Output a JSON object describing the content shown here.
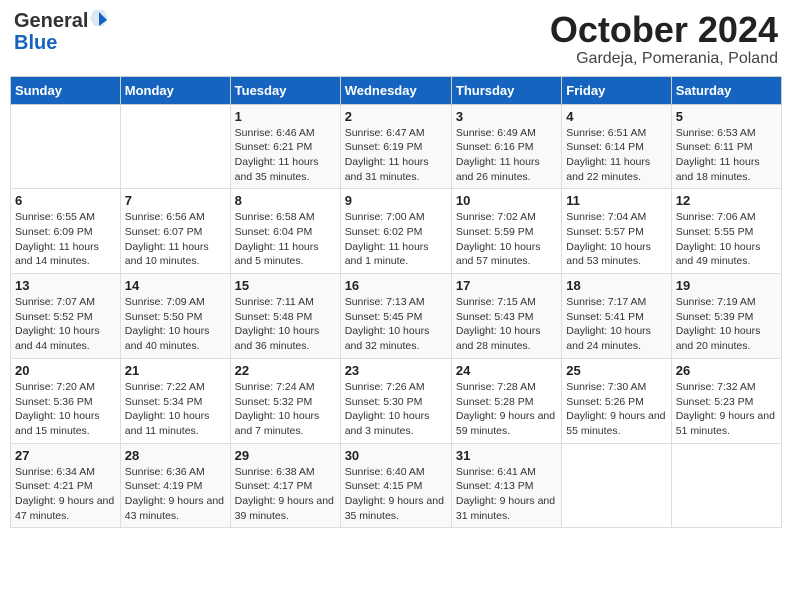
{
  "header": {
    "logo_general": "General",
    "logo_blue": "Blue",
    "title": "October 2024",
    "subtitle": "Gardeja, Pomerania, Poland"
  },
  "columns": [
    "Sunday",
    "Monday",
    "Tuesday",
    "Wednesday",
    "Thursday",
    "Friday",
    "Saturday"
  ],
  "weeks": [
    [
      {
        "day": "",
        "info": ""
      },
      {
        "day": "",
        "info": ""
      },
      {
        "day": "1",
        "info": "Sunrise: 6:46 AM\nSunset: 6:21 PM\nDaylight: 11 hours and 35 minutes."
      },
      {
        "day": "2",
        "info": "Sunrise: 6:47 AM\nSunset: 6:19 PM\nDaylight: 11 hours and 31 minutes."
      },
      {
        "day": "3",
        "info": "Sunrise: 6:49 AM\nSunset: 6:16 PM\nDaylight: 11 hours and 26 minutes."
      },
      {
        "day": "4",
        "info": "Sunrise: 6:51 AM\nSunset: 6:14 PM\nDaylight: 11 hours and 22 minutes."
      },
      {
        "day": "5",
        "info": "Sunrise: 6:53 AM\nSunset: 6:11 PM\nDaylight: 11 hours and 18 minutes."
      }
    ],
    [
      {
        "day": "6",
        "info": "Sunrise: 6:55 AM\nSunset: 6:09 PM\nDaylight: 11 hours and 14 minutes."
      },
      {
        "day": "7",
        "info": "Sunrise: 6:56 AM\nSunset: 6:07 PM\nDaylight: 11 hours and 10 minutes."
      },
      {
        "day": "8",
        "info": "Sunrise: 6:58 AM\nSunset: 6:04 PM\nDaylight: 11 hours and 5 minutes."
      },
      {
        "day": "9",
        "info": "Sunrise: 7:00 AM\nSunset: 6:02 PM\nDaylight: 11 hours and 1 minute."
      },
      {
        "day": "10",
        "info": "Sunrise: 7:02 AM\nSunset: 5:59 PM\nDaylight: 10 hours and 57 minutes."
      },
      {
        "day": "11",
        "info": "Sunrise: 7:04 AM\nSunset: 5:57 PM\nDaylight: 10 hours and 53 minutes."
      },
      {
        "day": "12",
        "info": "Sunrise: 7:06 AM\nSunset: 5:55 PM\nDaylight: 10 hours and 49 minutes."
      }
    ],
    [
      {
        "day": "13",
        "info": "Sunrise: 7:07 AM\nSunset: 5:52 PM\nDaylight: 10 hours and 44 minutes."
      },
      {
        "day": "14",
        "info": "Sunrise: 7:09 AM\nSunset: 5:50 PM\nDaylight: 10 hours and 40 minutes."
      },
      {
        "day": "15",
        "info": "Sunrise: 7:11 AM\nSunset: 5:48 PM\nDaylight: 10 hours and 36 minutes."
      },
      {
        "day": "16",
        "info": "Sunrise: 7:13 AM\nSunset: 5:45 PM\nDaylight: 10 hours and 32 minutes."
      },
      {
        "day": "17",
        "info": "Sunrise: 7:15 AM\nSunset: 5:43 PM\nDaylight: 10 hours and 28 minutes."
      },
      {
        "day": "18",
        "info": "Sunrise: 7:17 AM\nSunset: 5:41 PM\nDaylight: 10 hours and 24 minutes."
      },
      {
        "day": "19",
        "info": "Sunrise: 7:19 AM\nSunset: 5:39 PM\nDaylight: 10 hours and 20 minutes."
      }
    ],
    [
      {
        "day": "20",
        "info": "Sunrise: 7:20 AM\nSunset: 5:36 PM\nDaylight: 10 hours and 15 minutes."
      },
      {
        "day": "21",
        "info": "Sunrise: 7:22 AM\nSunset: 5:34 PM\nDaylight: 10 hours and 11 minutes."
      },
      {
        "day": "22",
        "info": "Sunrise: 7:24 AM\nSunset: 5:32 PM\nDaylight: 10 hours and 7 minutes."
      },
      {
        "day": "23",
        "info": "Sunrise: 7:26 AM\nSunset: 5:30 PM\nDaylight: 10 hours and 3 minutes."
      },
      {
        "day": "24",
        "info": "Sunrise: 7:28 AM\nSunset: 5:28 PM\nDaylight: 9 hours and 59 minutes."
      },
      {
        "day": "25",
        "info": "Sunrise: 7:30 AM\nSunset: 5:26 PM\nDaylight: 9 hours and 55 minutes."
      },
      {
        "day": "26",
        "info": "Sunrise: 7:32 AM\nSunset: 5:23 PM\nDaylight: 9 hours and 51 minutes."
      }
    ],
    [
      {
        "day": "27",
        "info": "Sunrise: 6:34 AM\nSunset: 4:21 PM\nDaylight: 9 hours and 47 minutes."
      },
      {
        "day": "28",
        "info": "Sunrise: 6:36 AM\nSunset: 4:19 PM\nDaylight: 9 hours and 43 minutes."
      },
      {
        "day": "29",
        "info": "Sunrise: 6:38 AM\nSunset: 4:17 PM\nDaylight: 9 hours and 39 minutes."
      },
      {
        "day": "30",
        "info": "Sunrise: 6:40 AM\nSunset: 4:15 PM\nDaylight: 9 hours and 35 minutes."
      },
      {
        "day": "31",
        "info": "Sunrise: 6:41 AM\nSunset: 4:13 PM\nDaylight: 9 hours and 31 minutes."
      },
      {
        "day": "",
        "info": ""
      },
      {
        "day": "",
        "info": ""
      }
    ]
  ]
}
